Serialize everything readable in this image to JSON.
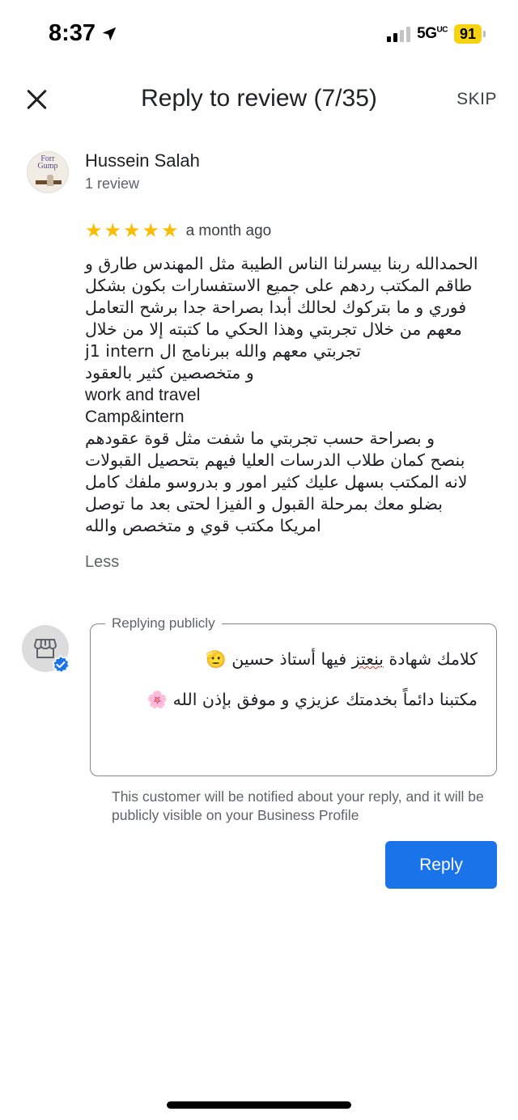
{
  "status_bar": {
    "time": "8:37",
    "network": "5G",
    "network_suffix": "UC",
    "battery": "91"
  },
  "header": {
    "title": "Reply to review (7/35)",
    "skip_label": "SKIP"
  },
  "reviewer": {
    "avatar_text_line1": "Forr",
    "avatar_text_line2": "Gump",
    "name": "Hussein Salah",
    "review_count": "1 review"
  },
  "review": {
    "rating": 5,
    "date": "a month ago",
    "lines": [
      "الحمدالله ربنا بيسرلنا الناس الطيبة مثل المهندس طارق و",
      "طاقم المكتب ردهم على جميع الاستفسارات بكون بشكل",
      "فوري و ما بتركوك لحالك أبدا بصراحة جدا برشح التعامل",
      "معهم من خلال تجربتي وهذا الحكي ما كتبته إلا من خلال",
      "تجربتي معهم والله ببرنامج ال j1 intern",
      "و متخصصين كثير بالعقود",
      "work and travel",
      "Camp&intern",
      "و بصراحة حسب تجربتي ما شفت مثل قوة عقودهم",
      "بنصح كمان طلاب الدرسات العليا فيهم بتحصيل القبولات",
      "لانه المكتب بسهل عليك كثير امور و بدروسو ملفك كامل",
      "بضلو معك  بمرحلة القبول و الفيزا لحتى بعد ما توصل",
      "امريكا مكتب قوي و متخصص والله"
    ],
    "less_label": "Less"
  },
  "reply": {
    "legend": "Replying publicly",
    "text_line1_before": "كلامك شهادة ",
    "text_line1_flag": "بنعتز",
    "text_line1_after": " فيها أستاذ حسين 🫡",
    "text_line2": "مكتبنا دائماً بخدمتك عزيزي و موفق بإذن الله 🌸",
    "notice": "This customer will be notified about your reply, and it will be publicly visible on your Business Profile",
    "button_label": "Reply"
  },
  "colors": {
    "accent": "#1a73e8",
    "star": "#fbbc04",
    "battery": "#f5d40f"
  }
}
